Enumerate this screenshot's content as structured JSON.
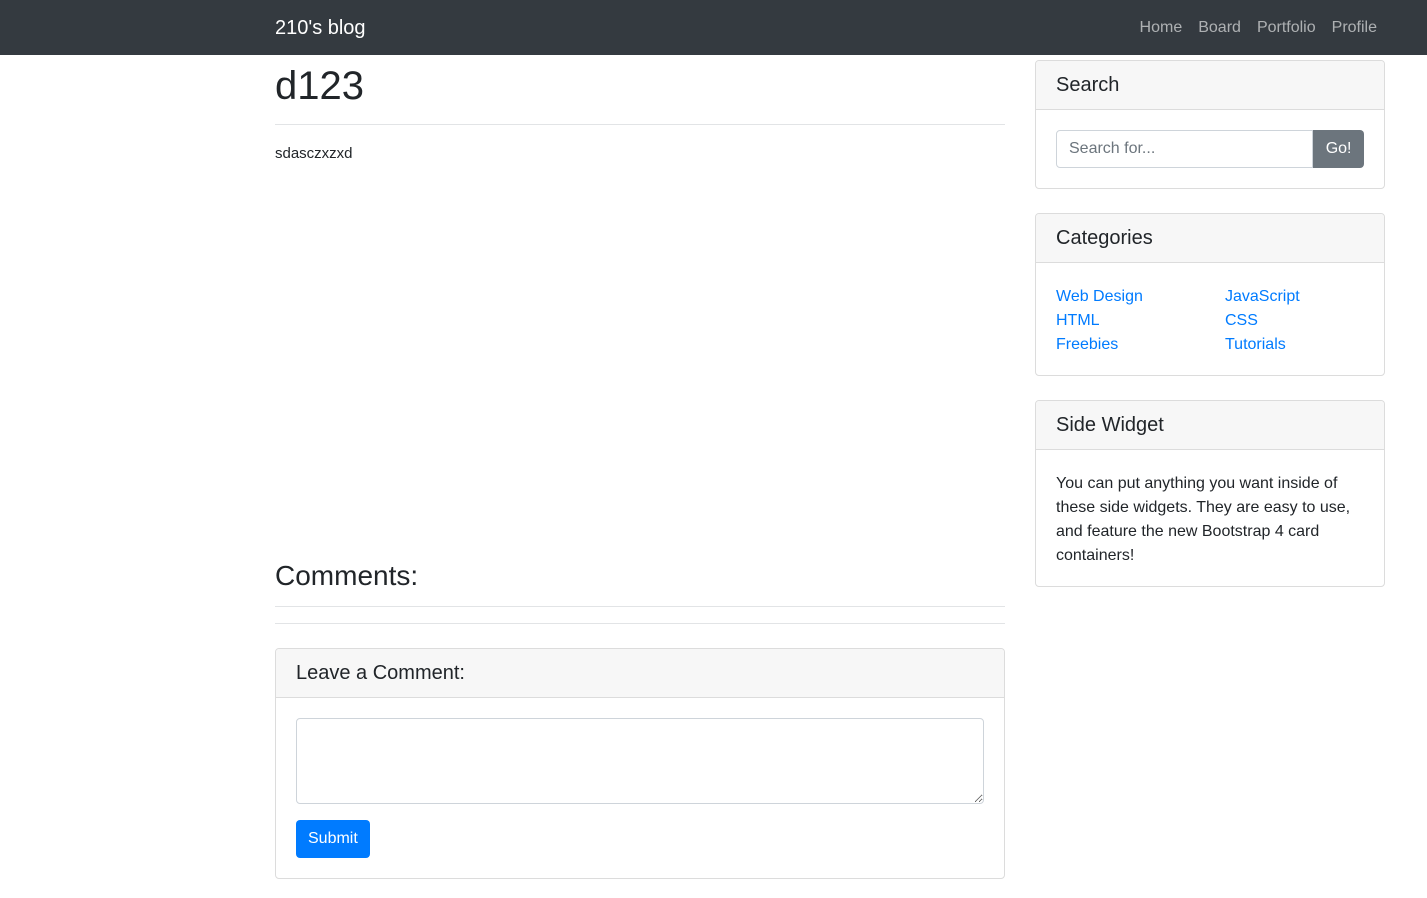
{
  "navbar": {
    "brand": "210's blog",
    "links": [
      "Home",
      "Board",
      "Portfolio",
      "Profile"
    ]
  },
  "post": {
    "title": "d123",
    "body": "sdasczxzxd"
  },
  "comments": {
    "title": "Comments:",
    "form_title": "Leave a Comment:",
    "textarea_value": "",
    "submit_label": "Submit"
  },
  "sidebar": {
    "search": {
      "title": "Search",
      "placeholder": "Search for...",
      "value": "",
      "button_label": "Go!"
    },
    "categories": {
      "title": "Categories",
      "items": [
        "Web Design",
        "JavaScript",
        "HTML",
        "CSS",
        "Freebies",
        "Tutorials"
      ]
    },
    "widget": {
      "title": "Side Widget",
      "text": "You can put anything you want inside of these side widgets. They are easy to use, and feature the new Bootstrap 4 card containers!"
    }
  },
  "colors": {
    "navbar_bg": "#343a40",
    "link": "#007bff",
    "primary_button": "#007bff",
    "secondary_button": "#6c757d"
  }
}
